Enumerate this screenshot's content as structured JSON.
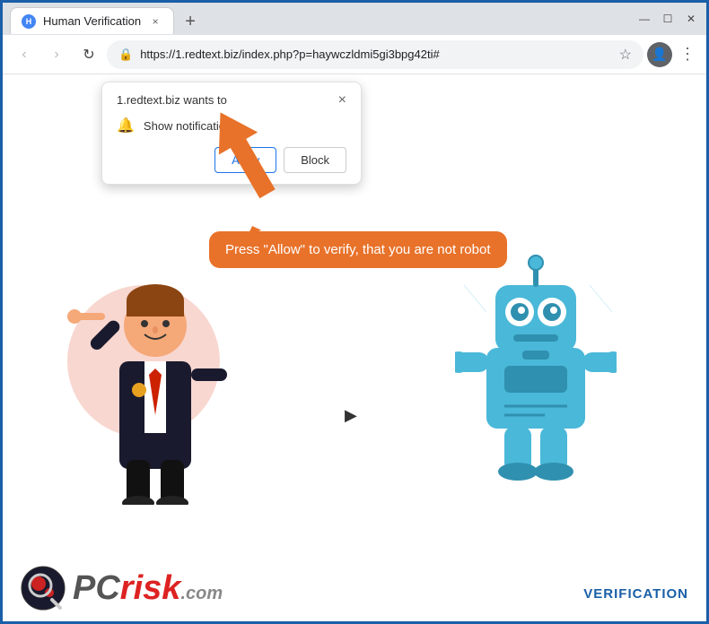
{
  "browser": {
    "tab": {
      "favicon_letter": "H",
      "title": "Human Verification",
      "close_label": "×"
    },
    "new_tab_btn": "+",
    "nav": {
      "back_label": "‹",
      "forward_label": "›",
      "refresh_label": "↻",
      "url": "https://1.redtext.biz/index.php?p=haywczldmi5gi3bpg42ti#",
      "lock_icon": "🔒",
      "star_icon": "☆",
      "profile_icon": "👤",
      "menu_icon": "⋮"
    },
    "window_controls": {
      "minimize": "—",
      "maximize": "☐",
      "close": "✕"
    }
  },
  "popup": {
    "title": "1.redtext.biz wants to",
    "close_label": "×",
    "notification_label": "Show notifications",
    "allow_label": "Allow",
    "block_label": "Block"
  },
  "speech_bubble": {
    "text": "Press \"Allow\" to verify, that you are not robot"
  },
  "footer": {
    "pc_text": "PC",
    "risk_text": "risk",
    "com_text": ".com",
    "verification_text": "VERIFICATION"
  }
}
